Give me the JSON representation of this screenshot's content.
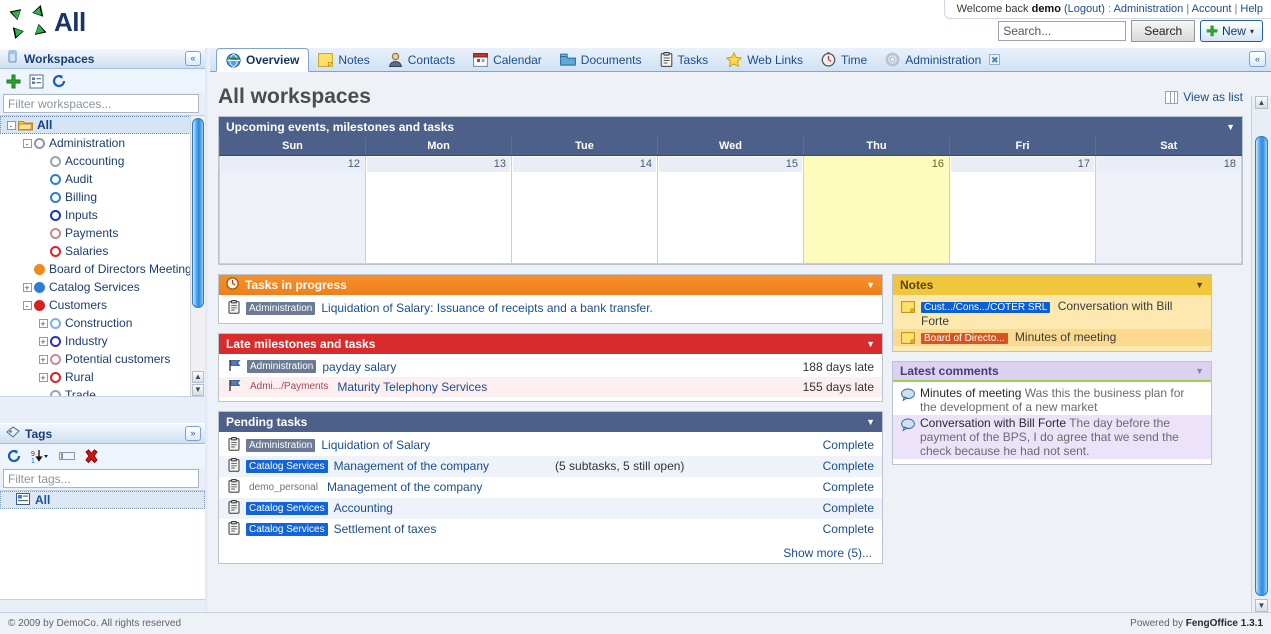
{
  "app": {
    "logo_text": "All",
    "footer_left": "© 2009 by DemoCo. All rights reserved",
    "footer_right_prefix": "Powered by",
    "footer_right_app": "FengOffice 1.3.1"
  },
  "header": {
    "welcome_prefix": "Welcome back",
    "user": "demo",
    "logout": "(Logout)",
    "sep": ":",
    "links": [
      "Administration",
      "Account",
      "Help"
    ],
    "search_placeholder": "Search...",
    "search_button": "Search",
    "new_button": "New",
    "new_caret": "▾"
  },
  "sidebar": {
    "workspaces_panel": {
      "title": "Workspaces",
      "collapse_icon": "«",
      "toolbar": [
        "add-icon",
        "list-icon",
        "refresh-icon"
      ],
      "filter_placeholder": "Filter workspaces...",
      "tree": [
        {
          "label": "All",
          "depth": 0,
          "twisty": "-",
          "icon": "folder",
          "selected": true
        },
        {
          "label": "Administration",
          "depth": 1,
          "twisty": "-",
          "icon": "dot",
          "color": "#8e98a8",
          "selected": false
        },
        {
          "label": "Accounting",
          "depth": 2,
          "twisty": "",
          "icon": "dot",
          "color": "#9aa3ad",
          "selected": false
        },
        {
          "label": "Audit",
          "depth": 2,
          "twisty": "",
          "icon": "dot",
          "color": "#2e7fd4",
          "selected": false
        },
        {
          "label": "Billing",
          "depth": 2,
          "twisty": "",
          "icon": "dot",
          "color": "#2e7fd4",
          "selected": false
        },
        {
          "label": "Inputs",
          "depth": 2,
          "twisty": "",
          "icon": "dot",
          "color": "#1a33c8",
          "selected": false
        },
        {
          "label": "Payments",
          "depth": 2,
          "twisty": "",
          "icon": "dot",
          "color": "#c08c93",
          "selected": false
        },
        {
          "label": "Salaries",
          "depth": 2,
          "twisty": "",
          "icon": "dot",
          "color": "#e02020",
          "selected": false
        },
        {
          "label": "Board of Directors Meeting",
          "depth": 1,
          "twisty": "",
          "icon": "dotfill",
          "color": "#f08a1c",
          "selected": false
        },
        {
          "label": "Catalog Services",
          "depth": 1,
          "twisty": "+",
          "icon": "dotfill",
          "color": "#2e7fd4",
          "selected": false
        },
        {
          "label": "Customers",
          "depth": 1,
          "twisty": "-",
          "icon": "dotfill",
          "color": "#d82020",
          "selected": false
        },
        {
          "label": "Construction",
          "depth": 2,
          "twisty": "+",
          "icon": "dot",
          "color": "#7fb0e0",
          "selected": false
        },
        {
          "label": "Industry",
          "depth": 2,
          "twisty": "+",
          "icon": "dot",
          "color": "#2b34b8",
          "selected": false
        },
        {
          "label": "Potential customers",
          "depth": 2,
          "twisty": "+",
          "icon": "dot",
          "color": "#c48f96",
          "selected": false
        },
        {
          "label": "Rural",
          "depth": 2,
          "twisty": "+",
          "icon": "dot",
          "color": "#e02020",
          "selected": false
        },
        {
          "label": "Trade",
          "depth": 2,
          "twisty": "",
          "icon": "dot",
          "color": "#9aa3ad",
          "selected": false
        }
      ]
    },
    "tags_panel": {
      "title": "Tags",
      "expand_icon": "»",
      "toolbar": [
        "refresh-icon",
        "sort-icon",
        "rename-icon",
        "delete-icon"
      ],
      "filter_placeholder": "Filter tags...",
      "items": [
        {
          "label": "All"
        }
      ]
    }
  },
  "tabs": [
    {
      "label": "Overview",
      "icon": "globe-icon",
      "active": true,
      "closable": false
    },
    {
      "label": "Notes",
      "icon": "note-icon",
      "active": false,
      "closable": false
    },
    {
      "label": "Contacts",
      "icon": "contact-icon",
      "active": false,
      "closable": false
    },
    {
      "label": "Calendar",
      "icon": "calendar-icon",
      "active": false,
      "closable": false
    },
    {
      "label": "Documents",
      "icon": "documents-icon",
      "active": false,
      "closable": false
    },
    {
      "label": "Tasks",
      "icon": "tasks-icon",
      "active": false,
      "closable": false
    },
    {
      "label": "Web Links",
      "icon": "star-icon",
      "active": false,
      "closable": false
    },
    {
      "label": "Time",
      "icon": "clock-icon",
      "active": false,
      "closable": false
    },
    {
      "label": "Administration",
      "icon": "gear-icon",
      "active": false,
      "closable": true
    }
  ],
  "tab_collapse_icon": "«",
  "page": {
    "title": "All workspaces",
    "view_as_list": "View as list"
  },
  "calendar_widget": {
    "title": "Upcoming events, milestones and tasks",
    "caret": "▼",
    "day_headers": [
      "Sun",
      "Mon",
      "Tue",
      "Wed",
      "Thu",
      "Fri",
      "Sat"
    ],
    "days": [
      {
        "num": "12",
        "style": "off"
      },
      {
        "num": "13",
        "style": "normal"
      },
      {
        "num": "14",
        "style": "normal"
      },
      {
        "num": "15",
        "style": "normal"
      },
      {
        "num": "16",
        "style": "today"
      },
      {
        "num": "17",
        "style": "normal"
      },
      {
        "num": "18",
        "style": "off"
      }
    ]
  },
  "tasks_in_progress": {
    "title": "Tasks in progress",
    "caret": "▼",
    "icon": "clock-icon",
    "rows": [
      {
        "chip": "Administration",
        "chip_style": "chip-gray",
        "text": "Liquidation of Salary: Issuance of receipts and a bank transfer.",
        "alt": false
      }
    ]
  },
  "late_milestones": {
    "title": "Late milestones and tasks",
    "caret": "▼",
    "rows": [
      {
        "chip": "Administration",
        "chip_style": "chip-gray",
        "text": "payday salary",
        "meta": "188 days late",
        "alt": false
      },
      {
        "chip": "Admi.../Payments",
        "chip_style": "chip-pinkish",
        "text": "Maturity Telephony Services",
        "meta": "155 days late",
        "alt": true
      }
    ]
  },
  "pending_tasks": {
    "title": "Pending tasks",
    "caret": "▼",
    "show_more": "Show more (5)...",
    "rows": [
      {
        "chip": "Administration",
        "chip_style": "chip-gray",
        "text": "Liquidation of Salary",
        "sub": "",
        "action": "Complete",
        "alt": false
      },
      {
        "chip": "Catalog Services",
        "chip_style": "chip-blue",
        "text": "Management of the company",
        "sub": "(5 subtasks, 5 still open)",
        "action": "Complete",
        "alt": true
      },
      {
        "chip": "demo_personal",
        "chip_style": "chip-plain",
        "text": "Management of the company",
        "sub": "",
        "action": "Complete",
        "alt": false
      },
      {
        "chip": "Catalog Services",
        "chip_style": "chip-blue",
        "text": "Accounting",
        "sub": "",
        "action": "Complete",
        "alt": true
      },
      {
        "chip": "Catalog Services",
        "chip_style": "chip-blue",
        "text": "Settlement of taxes",
        "sub": "",
        "action": "Complete",
        "alt": false
      }
    ]
  },
  "notes_widget": {
    "title": "Notes",
    "caret": "▼",
    "rows": [
      {
        "chip": "Cust.../Cons.../COTER SRL",
        "chip_style": "chip-blue2",
        "text": "Conversation with Bill Forte",
        "alt": false
      },
      {
        "chip": "Board of Directo...",
        "chip_style": "chip-orange",
        "text": "Minutes of meeting",
        "alt": true
      }
    ]
  },
  "comments_widget": {
    "title": "Latest comments",
    "caret": "▼",
    "rows": [
      {
        "title": "Minutes of meeting",
        "text": "Was this the business plan for the development of a new market",
        "alt": false
      },
      {
        "title": "Conversation with Bill Forte",
        "text": "The day before the payment of the BPS, I do agree that we send the check because he had not sent.",
        "alt": true
      }
    ]
  },
  "colors": {
    "widget_blue": "#4d6089",
    "widget_orange": "#f0841d",
    "widget_red": "#d92b2b",
    "widget_yellow": "#f0c73c",
    "widget_purple": "#ddd1f2",
    "today": "#fdfbbe",
    "accent_link": "#1b4e8e"
  }
}
